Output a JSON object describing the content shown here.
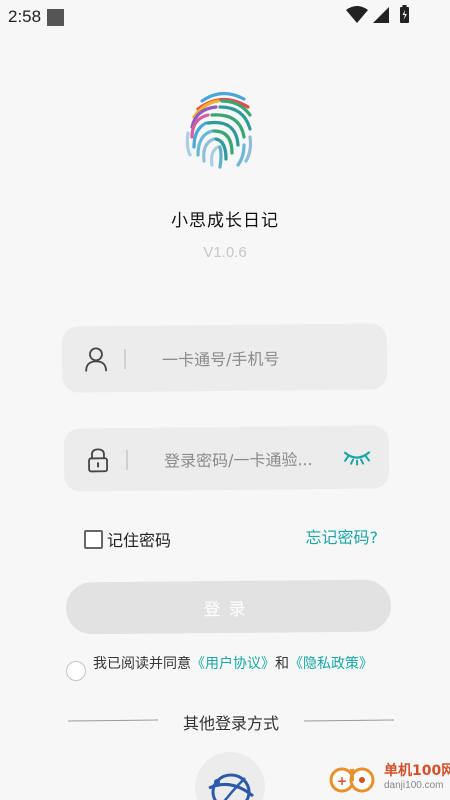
{
  "status_bar": {
    "time": "2:58"
  },
  "app": {
    "name": "小思成长日记",
    "version": "V1.0.6"
  },
  "login_form": {
    "username": {
      "placeholder": "一卡通号/手机号",
      "value": ""
    },
    "password": {
      "placeholder": "登录密码/一卡通验...",
      "value": ""
    },
    "remember_label": "记住密码",
    "remember_checked": false,
    "forgot_label": "忘记密码?",
    "login_label": "登录"
  },
  "agreement": {
    "prefix": "我已阅读并同意",
    "user_agreement": "《用户协议》",
    "conjunction": "和",
    "privacy_policy": "《隐私政策》",
    "accepted": false
  },
  "other_login": {
    "label": "其他登录方式"
  },
  "watermark": {
    "brand": "单机100网",
    "domain": "danji100.com"
  },
  "colors": {
    "accent": "#1aa6a6",
    "background": "#f7f7f7",
    "field": "#ececec",
    "button_disabled": "#e2e2e2"
  }
}
